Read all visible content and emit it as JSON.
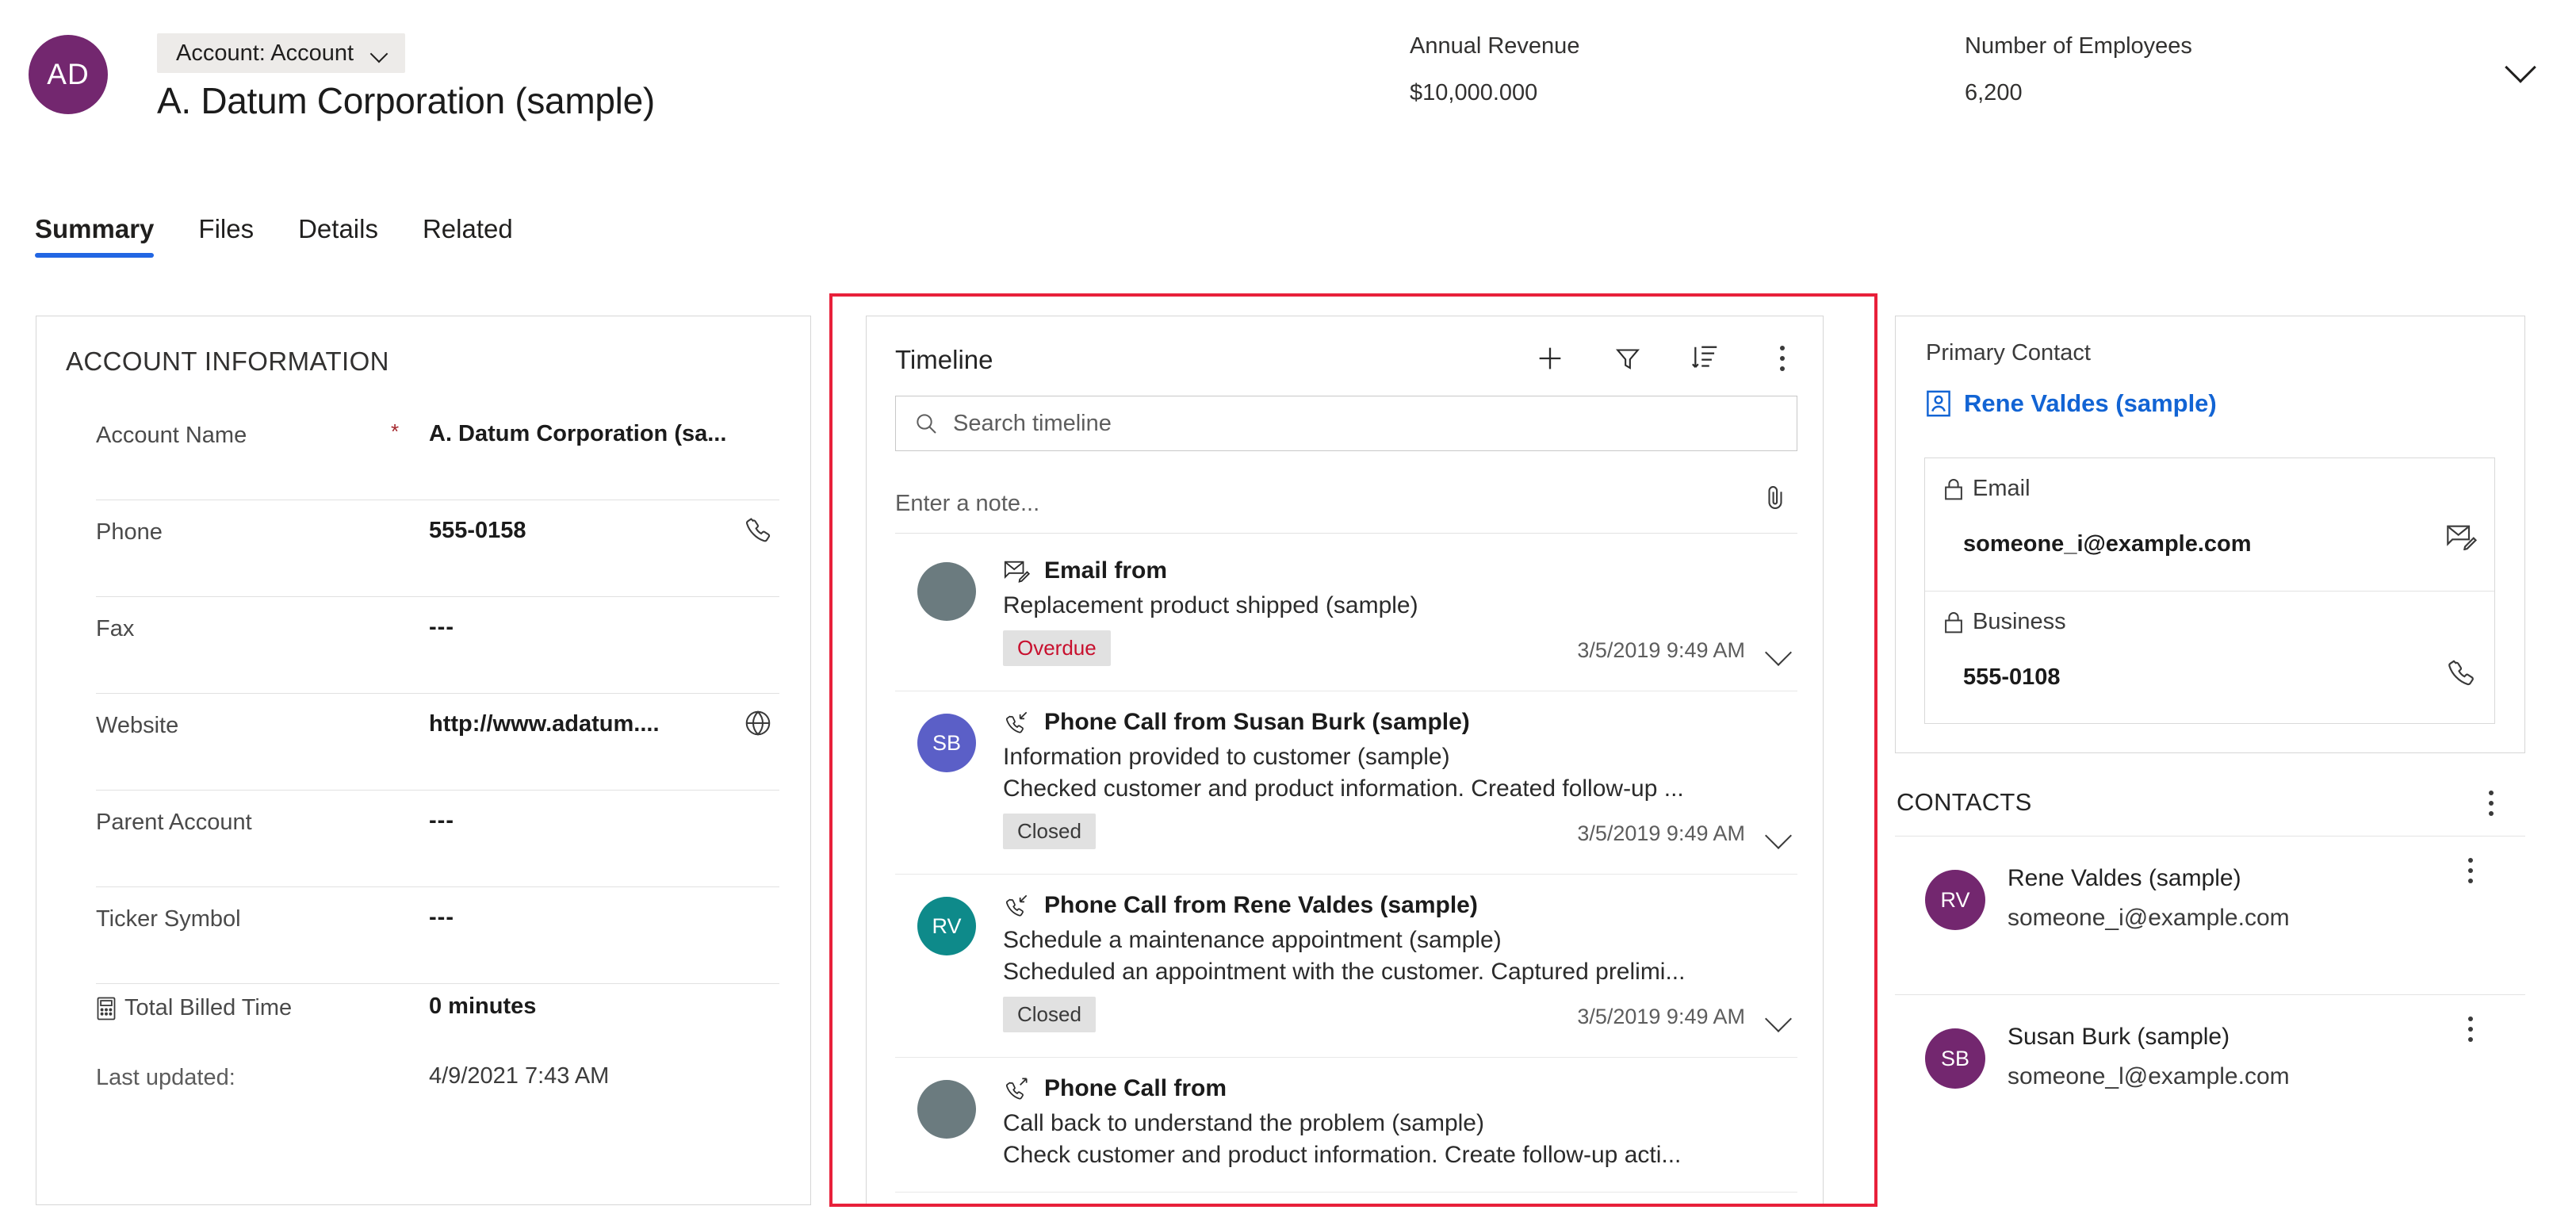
{
  "header": {
    "avatar_initials": "AD",
    "avatar_color": "#73276f",
    "entity_chip": "Account: Account",
    "record_title": "A. Datum Corporation (sample)",
    "stats": [
      {
        "label": "Annual Revenue",
        "value": "$10,000.000"
      },
      {
        "label": "Number of Employees",
        "value": "6,200"
      }
    ]
  },
  "tabs": [
    {
      "label": "Summary",
      "active": true
    },
    {
      "label": "Files",
      "active": false
    },
    {
      "label": "Details",
      "active": false
    },
    {
      "label": "Related",
      "active": false
    }
  ],
  "account_information": {
    "title": "ACCOUNT INFORMATION",
    "fields": [
      {
        "label": "Account Name",
        "value": "A. Datum Corporation (sa...",
        "required": true,
        "icon": ""
      },
      {
        "label": "Phone",
        "value": "555-0158",
        "required": false,
        "icon": "phone-icon"
      },
      {
        "label": "Fax",
        "value": "---",
        "required": false,
        "icon": ""
      },
      {
        "label": "Website",
        "value": "http://www.adatum....",
        "required": false,
        "icon": "globe-icon"
      },
      {
        "label": "Parent Account",
        "value": "---",
        "required": false,
        "icon": ""
      },
      {
        "label": "Ticker Symbol",
        "value": "---",
        "required": false,
        "icon": ""
      }
    ],
    "billed_time": {
      "label": "Total Billed Time",
      "value": "0 minutes",
      "icon": "calculator-icon"
    },
    "last_updated": {
      "label": "Last updated:",
      "value": "4/9/2021 7:43 AM"
    }
  },
  "timeline": {
    "title": "Timeline",
    "actions": [
      {
        "name": "add-icon",
        "label": "Add"
      },
      {
        "name": "filter-icon",
        "label": "Filter"
      },
      {
        "name": "sort-icon",
        "label": "Sort"
      },
      {
        "name": "more-icon",
        "label": "More commands"
      }
    ],
    "search_placeholder": "Search timeline",
    "note_placeholder": "Enter a note...",
    "attach_label": "Attach",
    "entries": [
      {
        "avatar_initials": "",
        "avatar_color": "#6b7b7f",
        "icon": "email-icon",
        "type": "Email from",
        "subject": "Replacement product shipped (sample)",
        "description": "",
        "badge": "Overdue",
        "badge_style": "overdue",
        "date": "3/5/2019 9:49 AM"
      },
      {
        "avatar_initials": "SB",
        "avatar_color": "#5b5fc7",
        "icon": "phone-incoming-icon",
        "type": "Phone Call from Susan Burk (sample)",
        "subject": "Information provided to customer (sample)",
        "description": "Checked customer and product information. Created follow-up ...",
        "badge": "Closed",
        "badge_style": "closed",
        "date": "3/5/2019 9:49 AM"
      },
      {
        "avatar_initials": "RV",
        "avatar_color": "#0e8a8a",
        "icon": "phone-incoming-icon",
        "type": "Phone Call from Rene Valdes (sample)",
        "subject": "Schedule a maintenance appointment (sample)",
        "description": "Scheduled an appointment with the customer. Captured prelimi...",
        "badge": "Closed",
        "badge_style": "closed",
        "date": "3/5/2019 9:49 AM"
      },
      {
        "avatar_initials": "",
        "avatar_color": "#6b7b7f",
        "icon": "phone-outgoing-icon",
        "type": "Phone Call from",
        "subject": "Call back to understand the problem (sample)",
        "description": "Check customer and product information. Create follow-up acti...",
        "badge": "",
        "badge_style": "",
        "date": ""
      }
    ]
  },
  "primary_contact": {
    "label": "Primary Contact",
    "link": "Rene Valdes (sample)",
    "link_color": "#1264d4",
    "fields": [
      {
        "label": "Email",
        "value": "someone_i@example.com",
        "lock": true,
        "icon": "email-edit-icon"
      },
      {
        "label": "Business",
        "value": "555-0108",
        "lock": true,
        "icon": "phone-icon"
      }
    ]
  },
  "contacts": {
    "title": "CONTACTS",
    "items": [
      {
        "initials": "RV",
        "name": "Rene Valdes (sample)",
        "email": "someone_i@example.com"
      },
      {
        "initials": "SB",
        "name": "Susan Burk (sample)",
        "email": "someone_l@example.com"
      }
    ]
  },
  "highlight": {
    "color": "#e8203a"
  }
}
